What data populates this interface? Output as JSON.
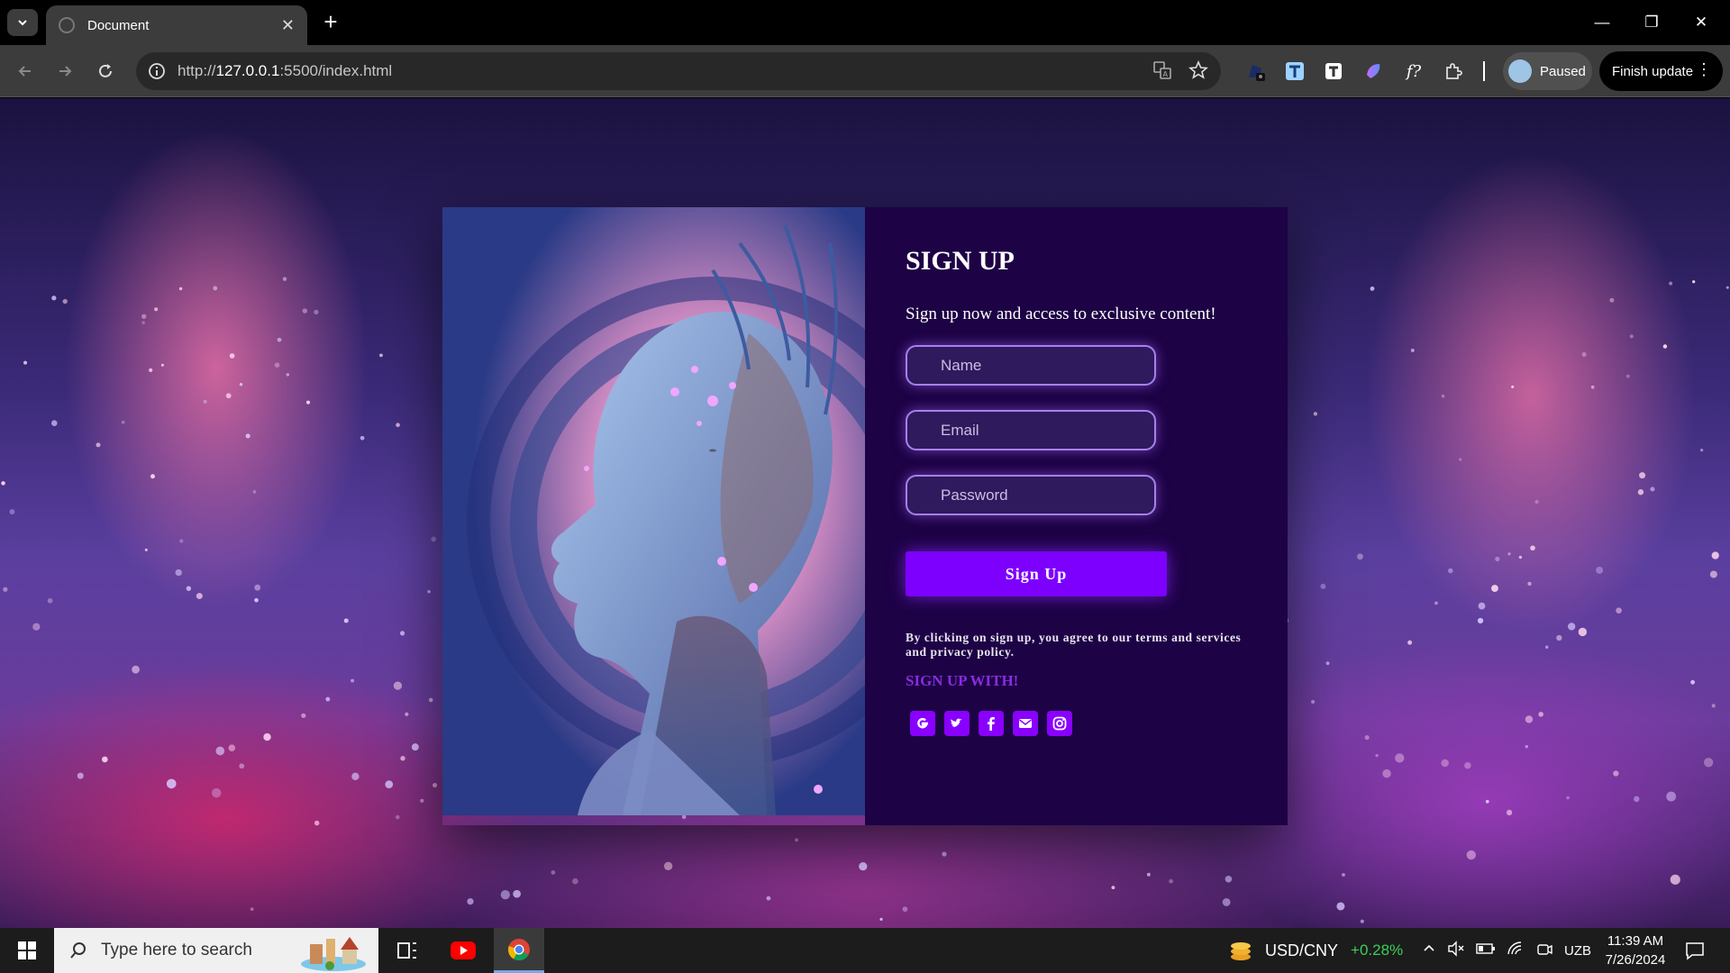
{
  "browser": {
    "tab_title": "Document",
    "url_prefix": "http://",
    "url_host": "127.0.0.1",
    "url_rest": ":5500/index.html",
    "profile_label": "Paused",
    "update_label": "Finish update"
  },
  "signup": {
    "title": "SIGN UP",
    "subtitle": "Sign up now and access to exclusive content!",
    "name_placeholder": "Name",
    "email_placeholder": "Email",
    "password_placeholder": "Password",
    "button_label": "Sign Up",
    "terms_text": "By clicking on sign up, you agree to our terms and services and privacy policy.",
    "social_heading": "SIGN UP WITH!",
    "socials": [
      "google-icon",
      "twitter-icon",
      "facebook-icon",
      "email-icon",
      "instagram-icon"
    ]
  },
  "taskbar": {
    "search_placeholder": "Type here to search",
    "ticker_pair": "USD/CNY",
    "ticker_change": "+0.28%",
    "language": "UZB",
    "time": "11:39 AM",
    "date": "7/26/2024"
  },
  "colors": {
    "form_bg": "#1d0245",
    "accent": "#7d00ff",
    "social_heading": "#8a2be2",
    "ticker_up": "#3ccf5a"
  }
}
